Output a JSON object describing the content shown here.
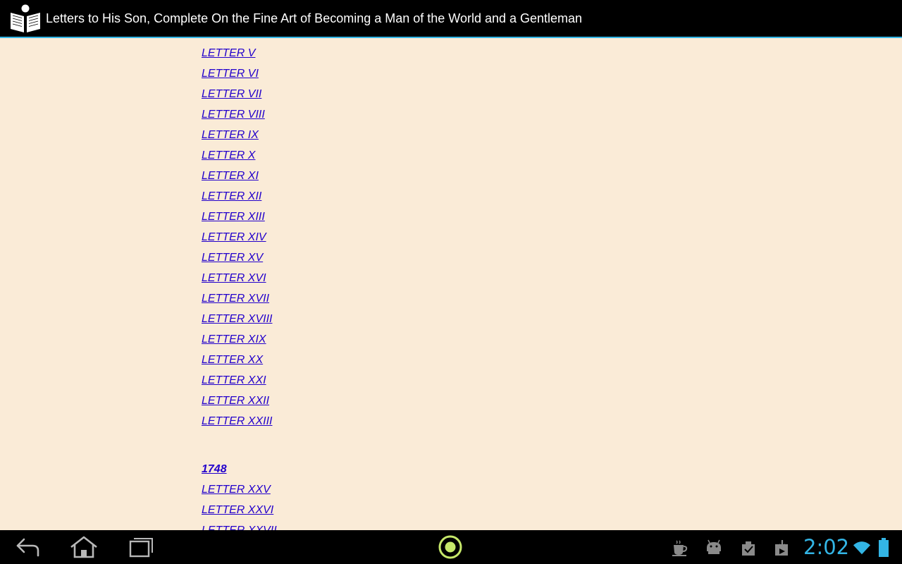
{
  "app": {
    "title": "Letters to His Son, Complete On the Fine Art of Becoming a Man of the World and a Gentleman"
  },
  "toc": {
    "letters_a": [
      "LETTER V",
      "LETTER VI",
      "LETTER VII",
      "LETTER VIII",
      "LETTER IX",
      "LETTER X",
      "LETTER XI",
      "LETTER XII",
      "LETTER XIII",
      "LETTER XIV",
      "LETTER XV",
      "LETTER XVI",
      "LETTER XVII",
      "LETTER XVIII",
      "LETTER XIX",
      "LETTER XX",
      "LETTER XXI",
      "LETTER XXII",
      "LETTER XXIII"
    ],
    "year_heading": "1748",
    "letters_b": [
      "LETTER XXV",
      "LETTER XXVI",
      "LETTER XXVII"
    ]
  },
  "status_bar": {
    "time": "2:02",
    "icons": [
      "coffee-cup-icon",
      "android-icon",
      "clipboard-check-icon",
      "download-store-icon",
      "wifi-icon",
      "battery-icon"
    ]
  },
  "nav_bar": {
    "buttons": [
      "back-icon",
      "home-icon",
      "recent-apps-icon",
      "app-center-icon"
    ]
  },
  "colors": {
    "accent": "#33b5e5",
    "link": "#2200cc",
    "page_background": "#faebd7"
  }
}
